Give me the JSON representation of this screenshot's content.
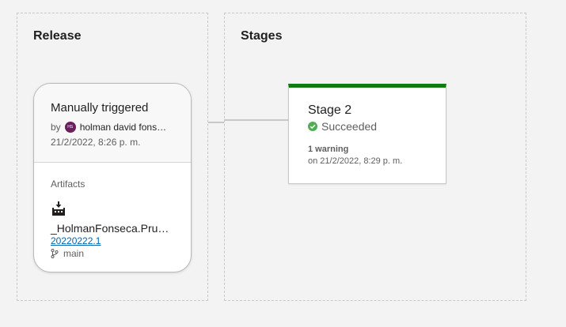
{
  "release_panel": {
    "title": "Release",
    "card": {
      "trigger": "Manually triggered",
      "by_label": "by",
      "avatar_initials": "HS",
      "user": "holman david fons…",
      "date": "21/2/2022, 8:26 p. m.",
      "artifacts_label": "Artifacts",
      "artifact": {
        "name": "_HolmanFonseca.Pru…",
        "version": "20220222.1",
        "branch": "main"
      }
    }
  },
  "stages_panel": {
    "title": "Stages",
    "stage": {
      "name": "Stage 2",
      "status": "Succeeded",
      "warning": "1 warning",
      "when": "on 21/2/2022, 8:29 p. m.",
      "status_color": "#107c10"
    }
  },
  "icons": [
    "user-avatar",
    "build-artifact-icon",
    "branch-icon",
    "succeeded-check-icon"
  ]
}
